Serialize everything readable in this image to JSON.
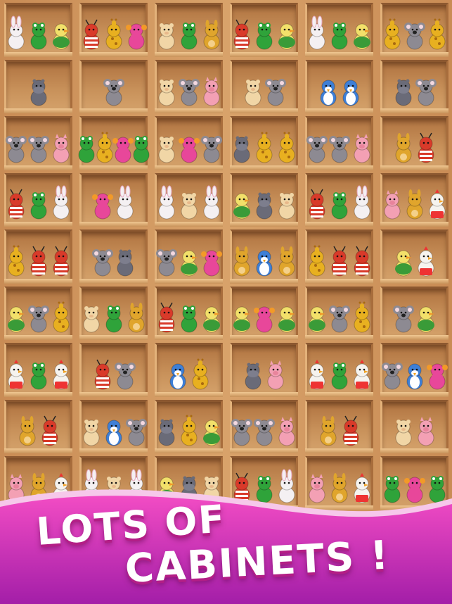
{
  "headline": {
    "line1": "LOTS OF",
    "line2": "CABINETS !"
  },
  "colors": {
    "banner_top": "#ee3fbd",
    "banner_bottom": "#a81fa6",
    "text": "#ffffff"
  },
  "shelves": [
    [
      [
        "bunny",
        "frog",
        "duck"
      ],
      [
        "ant",
        "giraffe",
        "crab"
      ],
      [
        "hamster",
        "frog",
        "kangaroo"
      ],
      [
        "ant",
        "frog",
        "duck"
      ],
      [
        "bunny",
        "frog",
        "duck"
      ],
      [
        "giraffe",
        "koala",
        "giraffe"
      ]
    ],
    [
      [
        "hippo"
      ],
      [
        "koala"
      ],
      [
        "hamster",
        "koala",
        "pig"
      ],
      [
        "hamster",
        "koala"
      ],
      [
        "penguin",
        "penguin"
      ],
      [
        "hippo",
        "koala"
      ],
      [
        "chicken",
        "frog",
        "chicken"
      ]
    ],
    [
      [
        "koala",
        "koala",
        "pig"
      ],
      [
        "frog",
        "giraffe",
        "crab",
        "frog"
      ],
      [
        "hamster",
        "crab",
        "koala"
      ],
      [
        "hippo",
        "giraffe",
        "giraffe"
      ],
      [
        "koala",
        "koala",
        "pig"
      ],
      [
        "kangaroo",
        "ant"
      ]
    ],
    [
      [
        "ant",
        "frog",
        "bunny"
      ],
      [
        "crab",
        "bunny"
      ],
      [
        "bunny",
        "hamster",
        "bunny"
      ],
      [
        "duck",
        "hippo",
        "hamster"
      ],
      [
        "ant",
        "frog",
        "bunny"
      ],
      [
        "pig",
        "kangaroo",
        "chicken"
      ]
    ],
    [
      [
        "giraffe",
        "ant",
        "ant"
      ],
      [
        "koala",
        "hippo"
      ],
      [
        "koala",
        "duck",
        "crab"
      ],
      [
        "kangaroo",
        "penguin",
        "kangaroo"
      ],
      [
        "giraffe",
        "ant",
        "ant"
      ],
      [
        "duck",
        "chicken"
      ]
    ],
    [
      [
        "duck",
        "koala",
        "giraffe"
      ],
      [
        "hamster",
        "frog",
        "kangaroo"
      ],
      [
        "ant",
        "frog",
        "duck"
      ],
      [
        "duck",
        "crab",
        "duck"
      ],
      [
        "duck",
        "koala",
        "giraffe"
      ],
      [
        "koala",
        "duck"
      ]
    ],
    [
      [
        "chicken",
        "frog",
        "chicken"
      ],
      [
        "ant",
        "koala"
      ],
      [
        "penguin",
        "giraffe"
      ],
      [
        "hippo",
        "pig"
      ],
      [
        "chicken",
        "frog",
        "chicken"
      ],
      [
        "koala",
        "penguin",
        "crab"
      ]
    ],
    [
      [
        "kangaroo",
        "ant"
      ],
      [
        "hamster",
        "penguin",
        "koala"
      ],
      [
        "hippo",
        "giraffe",
        "duck"
      ],
      [
        "koala",
        "koala",
        "pig"
      ],
      [
        "kangaroo",
        "ant"
      ],
      [
        "hamster",
        "pig"
      ]
    ],
    [
      [
        "pig",
        "kangaroo",
        "chicken"
      ],
      [
        "bunny",
        "hamster",
        "bunny"
      ],
      [
        "duck",
        "hippo",
        "hamster"
      ],
      [
        "ant",
        "frog",
        "bunny"
      ],
      [
        "pig",
        "kangaroo",
        "chicken"
      ],
      [
        "frog",
        "crab",
        "frog"
      ]
    ]
  ],
  "toy_colors": {
    "bunny": "#f4f0f2",
    "frog": "#2fa33a",
    "duck": "#f2e06a",
    "ant": "#d93a2a",
    "giraffe": "#e8b020",
    "crab": "#e8479a",
    "hamster": "#f1d6a6",
    "kangaroo": "#e0a52c",
    "koala": "#8d8a92",
    "hippo": "#6a6b78",
    "pig": "#f3a0b4",
    "penguin": "#3e7fd6",
    "chicken": "#f6f3ee"
  }
}
